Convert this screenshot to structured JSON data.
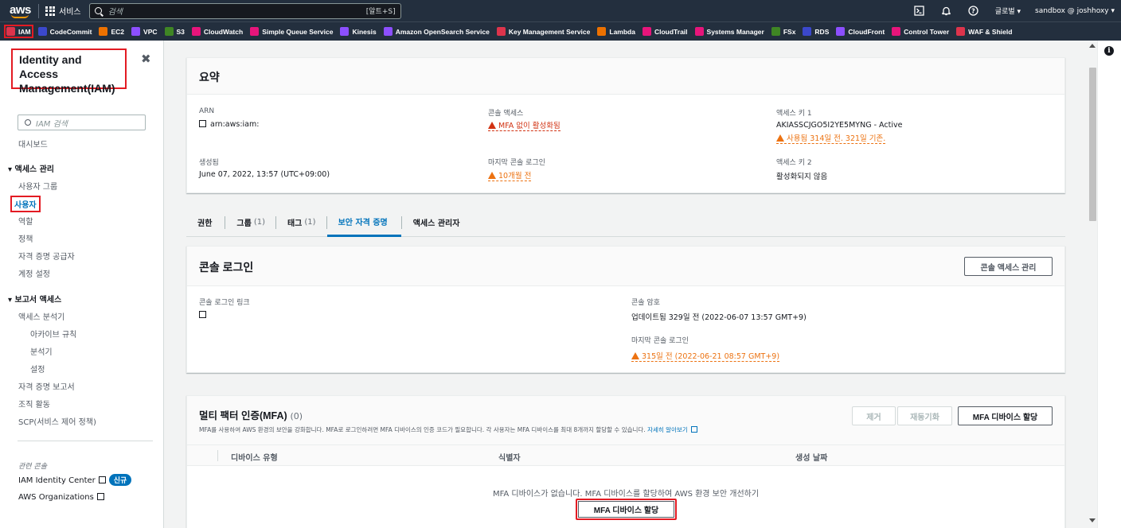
{
  "topbar": {
    "logo_text": "aws",
    "services_label": "서비스",
    "search_placeholder": "검색",
    "search_shortcut": "[알트+S]",
    "region_label": "글로벌 ▾",
    "account_label": "sandbox @ joshhoxy ▾"
  },
  "favorites": [
    {
      "label": "IAM",
      "color": "#dd344c"
    },
    {
      "label": "CodeCommit",
      "color": "#3b48cc"
    },
    {
      "label": "EC2",
      "color": "#ed7100"
    },
    {
      "label": "VPC",
      "color": "#8c4fff"
    },
    {
      "label": "S3",
      "color": "#3f8624"
    },
    {
      "label": "CloudWatch",
      "color": "#e7157b"
    },
    {
      "label": "Simple Queue Service",
      "color": "#e7157b"
    },
    {
      "label": "Kinesis",
      "color": "#8c4fff"
    },
    {
      "label": "Amazon OpenSearch Service",
      "color": "#8c4fff"
    },
    {
      "label": "Key Management Service",
      "color": "#dd344c"
    },
    {
      "label": "Lambda",
      "color": "#ed7100"
    },
    {
      "label": "CloudTrail",
      "color": "#e7157b"
    },
    {
      "label": "Systems Manager",
      "color": "#e7157b"
    },
    {
      "label": "FSx",
      "color": "#3f8624"
    },
    {
      "label": "RDS",
      "color": "#3b48cc"
    },
    {
      "label": "CloudFront",
      "color": "#8c4fff"
    },
    {
      "label": "Control Tower",
      "color": "#e7157b"
    },
    {
      "label": "WAF & Shield",
      "color": "#dd344c"
    }
  ],
  "sidebar": {
    "title": "Identity and Access Management(IAM)",
    "close": "✖",
    "search_placeholder": "IAM 검색",
    "dashboard": "대시보드",
    "access_mgmt": "▾ 액세스 관리",
    "user_groups": "사용자 그룹",
    "users": "사용자",
    "roles": "역할",
    "policies": "정책",
    "identity_providers": "자격 증명 공급자",
    "account_settings": "계정 설정",
    "access_reports": "▾ 보고서 액세스",
    "access_analyzer": "액세스 분석기",
    "archive_rules": "아카이브 규칙",
    "analyzers": "분석기",
    "settings": "설정",
    "credential_report": "자격 증명 보고서",
    "org_activity": "조직 활동",
    "scp": "SCP(서비스 제어 정책)",
    "related": "관련 콘솔",
    "identity_center": "IAM Identity Center",
    "new_badge": "신규",
    "organizations": "AWS Organizations"
  },
  "summary": {
    "title": "요약",
    "arn_label": "ARN",
    "arn_value": "arn:aws:iam:",
    "console_access_label": "콘솔 액세스",
    "console_access_value": "MFA 없이 활성화됨",
    "access_key1_label": "액세스 키 1",
    "access_key1_value": "AKIASSCJGO5I2YE5MYNG - Active",
    "access_key1_warn": "사용됨 314일 전. 321일 기존.",
    "created_label": "생성됨",
    "created_value": "June 07, 2022, 13:57 (UTC+09:00)",
    "last_login_label": "마지막 콘솔 로그인",
    "last_login_value": "10개월 전",
    "access_key2_label": "액세스 키 2",
    "access_key2_value": "활성화되지 않음"
  },
  "tabs": [
    {
      "label": "권한",
      "count": ""
    },
    {
      "label": "그룹",
      "count": "(1)"
    },
    {
      "label": "태그",
      "count": "(1)"
    },
    {
      "label": "보안 자격 증명",
      "count": ""
    },
    {
      "label": "액세스 관리자",
      "count": ""
    }
  ],
  "console_login": {
    "title": "콘솔 로그인",
    "manage_button": "콘솔 액세스 관리",
    "link_label": "콘솔 로그인 링크",
    "password_label": "콘솔 암호",
    "password_value": "업데이트됨 329일 전 (2022-06-07 13:57 GMT+9)",
    "last_login_label": "마지막 콘솔 로그인",
    "last_login_value": "315일 전 (2022-06-21 08:57 GMT+9)"
  },
  "mfa": {
    "title": "멀티 팩터 인증(MFA)",
    "count": "(0)",
    "description": "MFA를 사용하여 AWS 환경의 보안을 강화합니다. MFA로 로그인하려면 MFA 디바이스의 인증 코드가 필요합니다. 각 사용자는 MFA 디바이스를 최대 8개까지 할당할 수 있습니다.",
    "learn_more": "자세히 알아보기",
    "remove_button": "제거",
    "resync_button": "재동기화",
    "assign_button": "MFA 디바이스 할당",
    "col_device_type": "디바이스 유형",
    "col_identifier": "식별자",
    "col_created": "생성 날짜",
    "empty_text": "MFA 디바이스가 없습니다. MFA 디바이스를 할당하여 AWS 환경 보안 개선하기",
    "empty_assign_button": "MFA 디바이스 할당"
  },
  "info_icon_label": "i"
}
